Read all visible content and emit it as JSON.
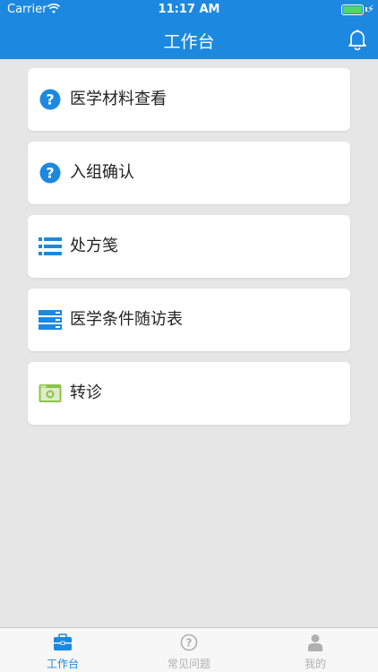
{
  "status_bar": {
    "carrier": "Carrier",
    "time": "11:17 AM"
  },
  "nav": {
    "title": "工作台"
  },
  "cards": [
    {
      "label": "医学材料查看",
      "icon": "question-circle-icon"
    },
    {
      "label": "入组确认",
      "icon": "question-circle-icon"
    },
    {
      "label": "处方笺",
      "icon": "list-icon"
    },
    {
      "label": "医学条件随访表",
      "icon": "table-icon"
    },
    {
      "label": "转诊",
      "icon": "camera-icon"
    }
  ],
  "tabs": [
    {
      "label": "工作台",
      "icon": "briefcase-icon",
      "active": true
    },
    {
      "label": "常见问题",
      "icon": "question-icon",
      "active": false
    },
    {
      "label": "我的",
      "icon": "user-icon",
      "active": false
    }
  ],
  "colors": {
    "primary": "#1d88e0",
    "background": "#e6e6e6",
    "card": "#ffffff",
    "tab_inactive": "#b0b0b0",
    "icon_green": "#8bc34a"
  }
}
